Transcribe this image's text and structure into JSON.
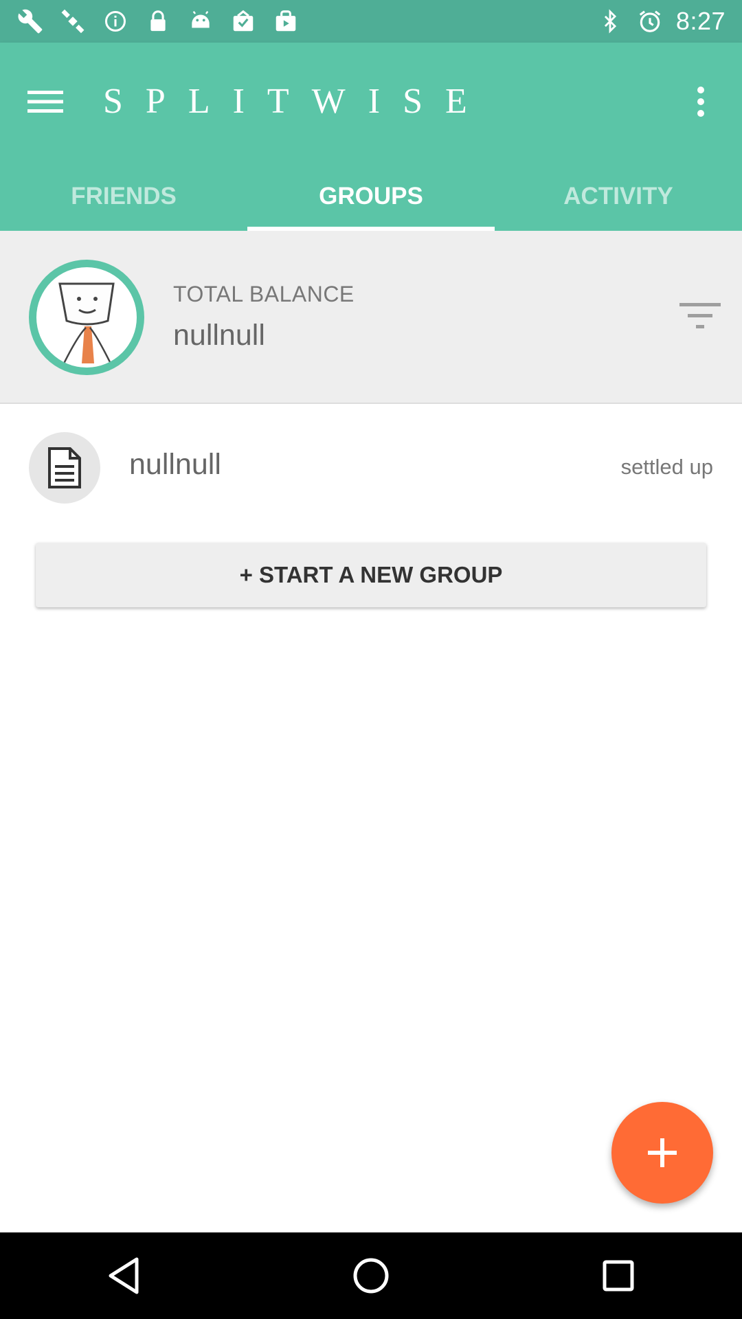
{
  "status_bar": {
    "time": "8:27",
    "left_icons": [
      "wrench-icon",
      "satellite-fake-gps-icon",
      "info-icon",
      "lock-icon",
      "android-icon",
      "clipboard-check-icon",
      "shopping-bag-icon"
    ],
    "right_icons": [
      "bluetooth-icon",
      "alarm-icon"
    ]
  },
  "app_bar": {
    "title": "SPLITWISE",
    "tabs": [
      {
        "label": "FRIENDS",
        "active": false
      },
      {
        "label": "GROUPS",
        "active": true
      },
      {
        "label": "ACTIVITY",
        "active": false
      }
    ]
  },
  "balance": {
    "label": "TOTAL BALANCE",
    "value": "nullnull"
  },
  "groups": [
    {
      "name": "nullnull",
      "status": "settled up",
      "icon": "document-icon"
    }
  ],
  "actions": {
    "new_group_label": "+ START A NEW GROUP"
  },
  "colors": {
    "primary": "#5bc5a7",
    "status_bar": "#4fae96",
    "fab": "#ff6b35"
  }
}
